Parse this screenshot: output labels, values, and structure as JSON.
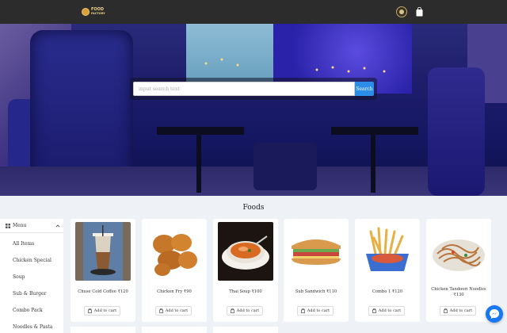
{
  "header": {
    "logo_text_line1": "FOOD",
    "logo_text_line2": "FACTORY"
  },
  "hero": {
    "search_placeholder": "input search text",
    "search_button": "Search"
  },
  "section": {
    "title": "Foods"
  },
  "sidebar": {
    "menu_label": "Menu",
    "items": [
      {
        "label": "All Items"
      },
      {
        "label": "Chicken Special"
      },
      {
        "label": "Soup"
      },
      {
        "label": "Sub & Burger"
      },
      {
        "label": "Combo Pack"
      },
      {
        "label": "Noodles & Pasta"
      }
    ]
  },
  "products": [
    {
      "name": "Chuse Cold Coffee ₹120",
      "button": "Add to cart",
      "icon": "coffee"
    },
    {
      "name": "Chicken Fry ₹90",
      "button": "Add to cart",
      "icon": "fried-chicken"
    },
    {
      "name": "Thai Soup ₹100",
      "button": "Add to cart",
      "icon": "soup"
    },
    {
      "name": "Sub Sandwich ₹110",
      "button": "Add to cart",
      "icon": "sandwich"
    },
    {
      "name": "Combo 1 ₹120",
      "button": "Add to cart",
      "icon": "fries"
    },
    {
      "name": "Chicken Tandoori Noodles",
      "price": "₹130",
      "button": "Add to cart",
      "icon": "noodles"
    }
  ],
  "colors": {
    "accent": "#2b8de8",
    "topbar": "#2c2c2c",
    "messenger": "#1877f2"
  }
}
